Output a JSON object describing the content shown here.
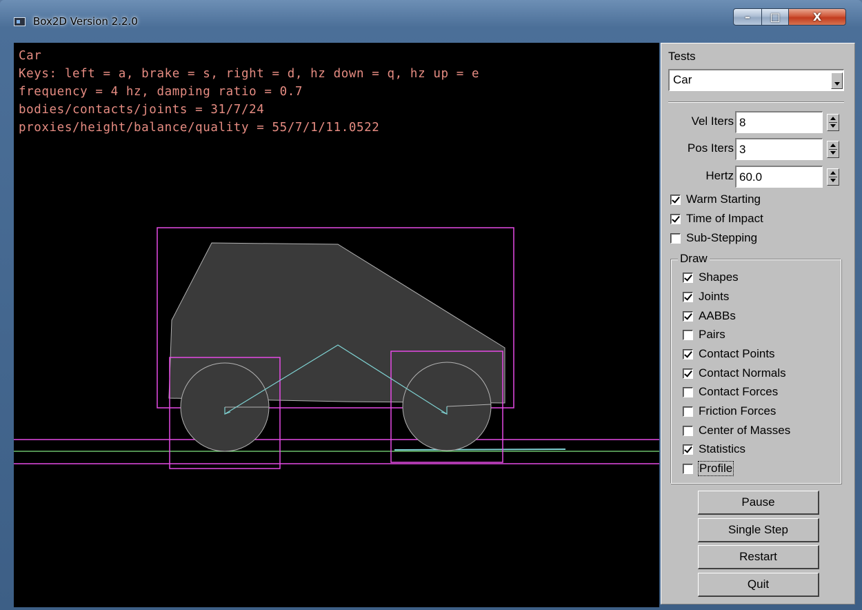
{
  "window": {
    "title": "Box2D Version 2.2.0",
    "controls": {
      "minimize": "–",
      "maximize": "□",
      "close": "X"
    }
  },
  "colors": {
    "stats_text": "#e68c82",
    "aabb": "#e64be6",
    "joint": "#7fd2d2",
    "shape_fill": "#3a3a3a",
    "shape_outline": "#b3b3b3",
    "ground": "#7fe67f"
  },
  "stats": {
    "lines": [
      "Car",
      "Keys: left = a, brake = s, right = d, hz down = q, hz up = e",
      "frequency = 4 hz, damping ratio = 0.7",
      "bodies/contacts/joints = 31/7/24",
      "proxies/height/balance/quality = 55/7/1/11.0522"
    ]
  },
  "panel": {
    "tests_label": "Tests",
    "tests_selected": "Car",
    "spinners": [
      {
        "label": "Vel Iters",
        "value": "8"
      },
      {
        "label": "Pos Iters",
        "value": "3"
      },
      {
        "label": "Hertz",
        "value": "60.0"
      }
    ],
    "options": [
      {
        "label": "Warm Starting",
        "checked": true
      },
      {
        "label": "Time of Impact",
        "checked": true
      },
      {
        "label": "Sub-Stepping",
        "checked": false
      }
    ],
    "draw_label": "Draw",
    "draw_options": [
      {
        "label": "Shapes",
        "checked": true
      },
      {
        "label": "Joints",
        "checked": true
      },
      {
        "label": "AABBs",
        "checked": true
      },
      {
        "label": "Pairs",
        "checked": false
      },
      {
        "label": "Contact Points",
        "checked": true
      },
      {
        "label": "Contact Normals",
        "checked": true
      },
      {
        "label": "Contact Forces",
        "checked": false
      },
      {
        "label": "Friction Forces",
        "checked": false
      },
      {
        "label": "Center of Masses",
        "checked": false
      },
      {
        "label": "Statistics",
        "checked": true
      },
      {
        "label": "Profile",
        "checked": false
      }
    ],
    "buttons": {
      "pause": "Pause",
      "single_step": "Single Step",
      "restart": "Restart",
      "quit": "Quit"
    }
  }
}
